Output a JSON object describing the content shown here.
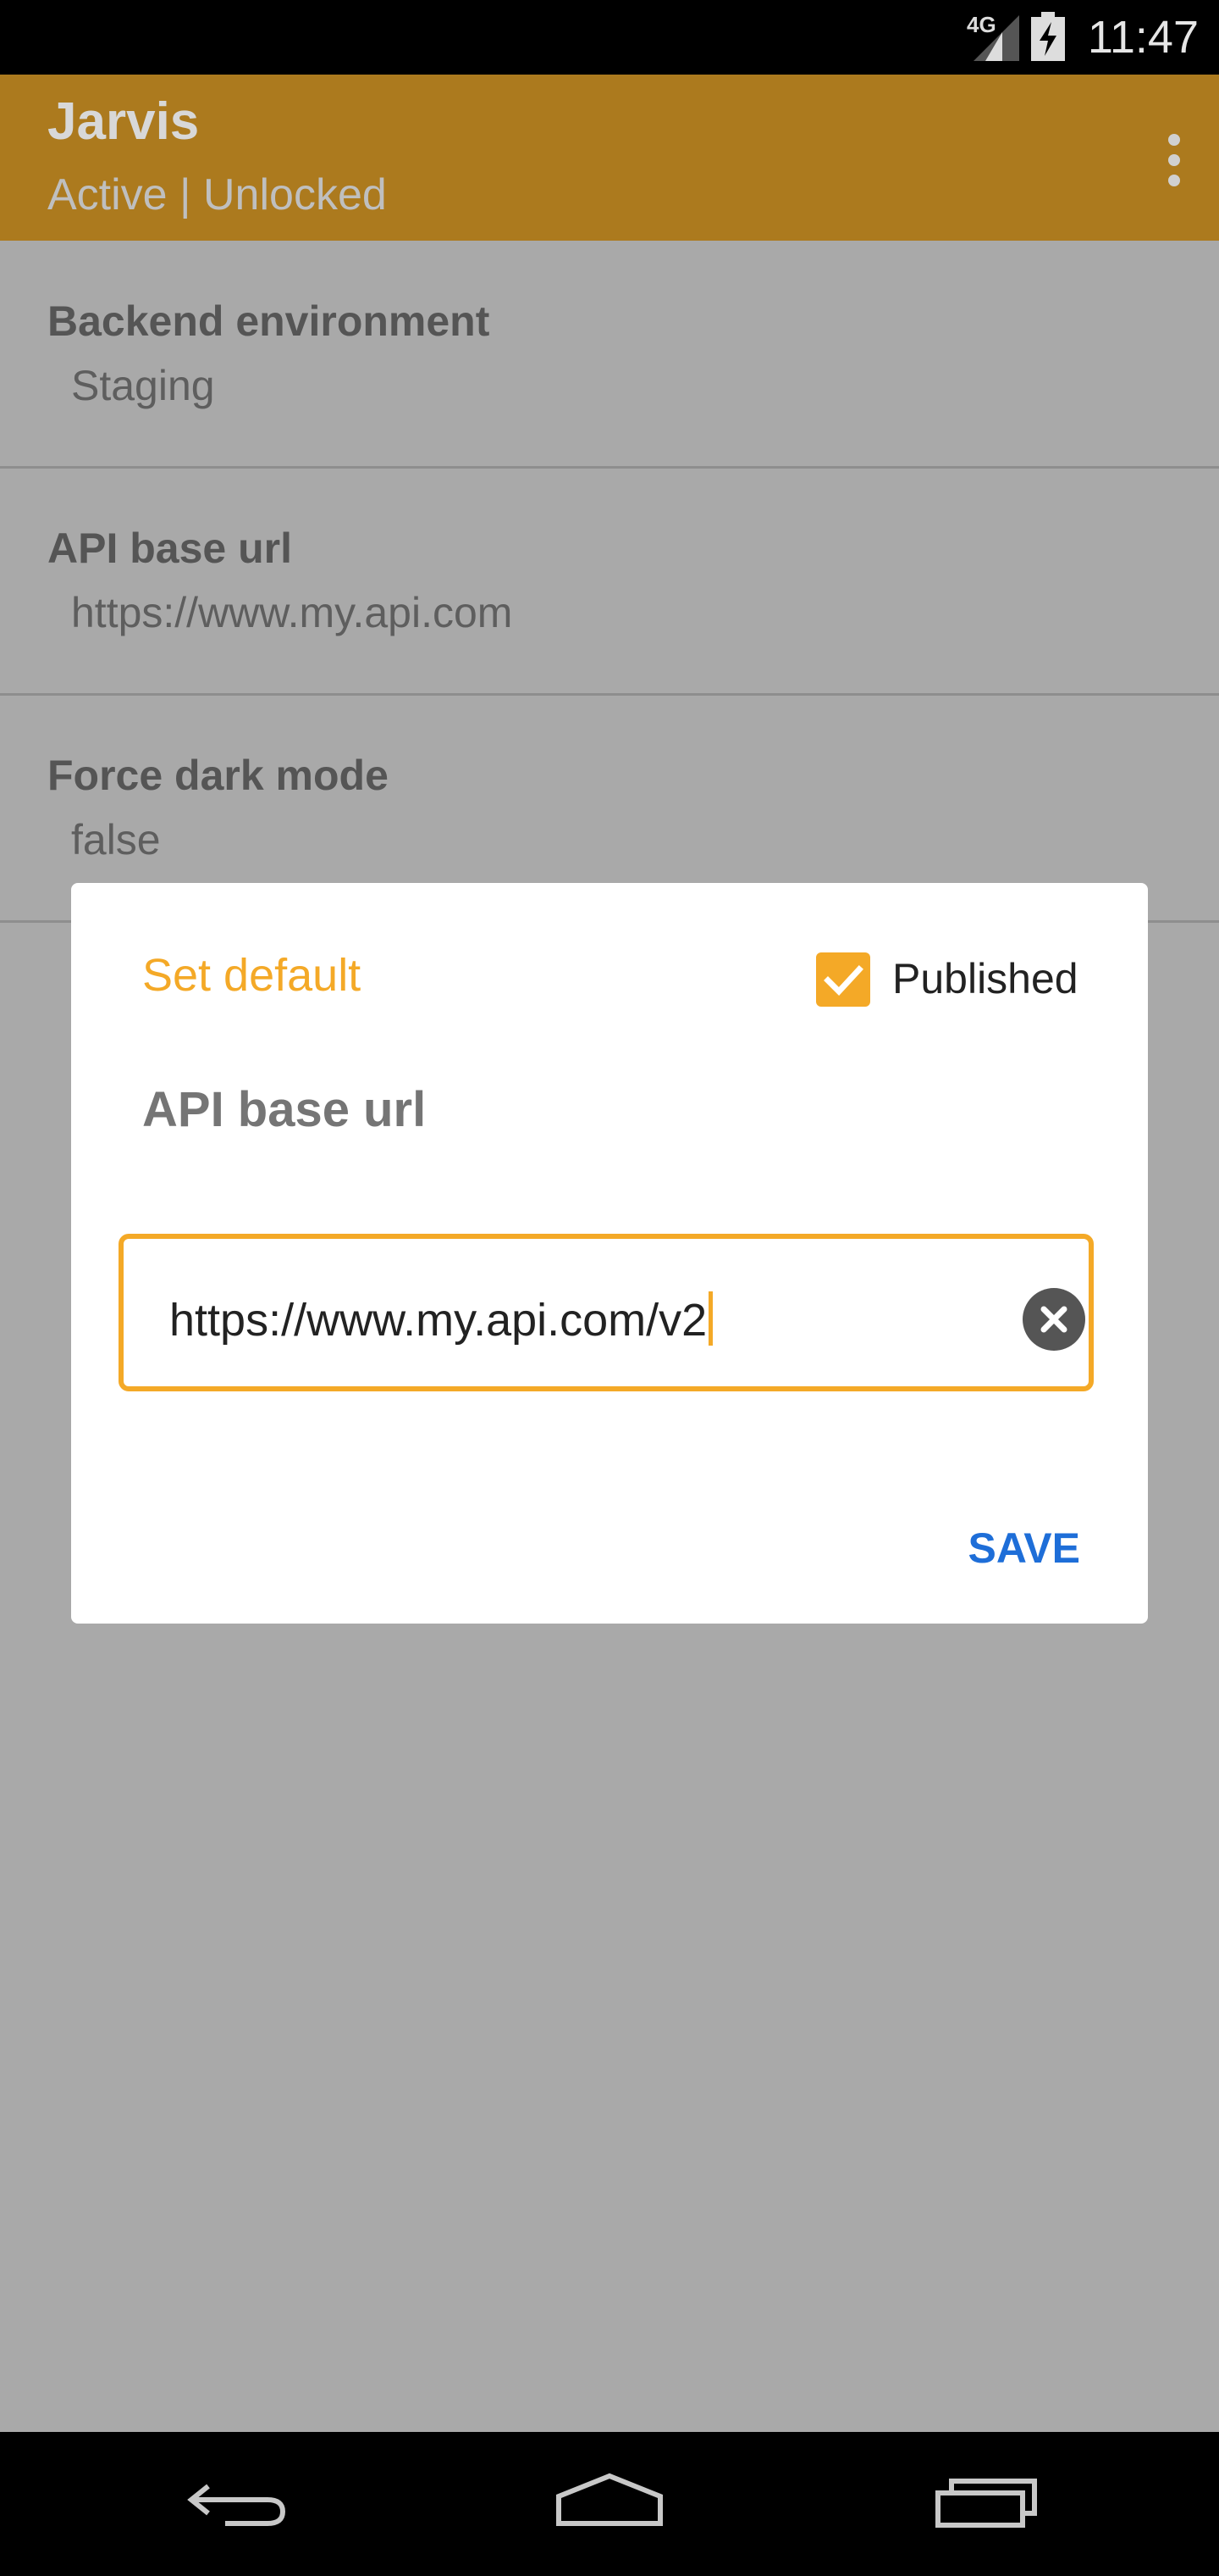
{
  "status_bar": {
    "network": "4G",
    "time": "11:47",
    "icons": [
      "signal-icon",
      "battery-charging-icon"
    ]
  },
  "app_bar": {
    "title": "Jarvis",
    "subtitle": "Active | Unlocked",
    "menu_icon": "overflow-menu-icon"
  },
  "settings": [
    {
      "title": "Backend environment",
      "value": "Staging"
    },
    {
      "title": "API base url",
      "value": "https://www.my.api.com"
    },
    {
      "title": "Force dark mode",
      "value": "false"
    }
  ],
  "dialog": {
    "set_default_label": "Set default",
    "published_label": "Published",
    "published_checked": true,
    "title": "API base url",
    "input_value": "https://www.my.api.com/v2",
    "clear_icon": "clear-icon",
    "save_label": "SAVE"
  },
  "nav_bar": {
    "icons": [
      "back-icon",
      "home-icon",
      "recents-icon"
    ]
  },
  "colors": {
    "accent": "#f4a927",
    "app_bar": "#ac7a1e",
    "save": "#1e6ed8",
    "scrim": "#a9a9a9"
  }
}
